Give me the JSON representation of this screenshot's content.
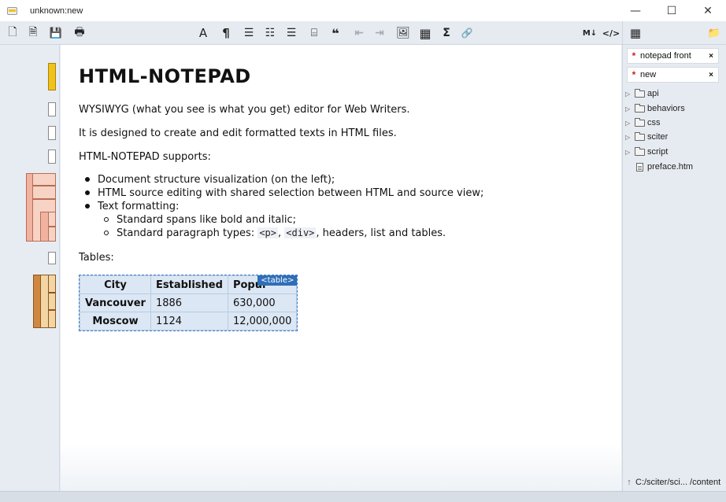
{
  "window": {
    "title": "unknown:new",
    "minimize": "—",
    "maximize": "☐",
    "close": "✕"
  },
  "toolbar": {
    "new": "🗋",
    "open": "🗎",
    "save": "💾",
    "print": "🖶",
    "font": "A",
    "paragraph": "¶",
    "bullets": "☰",
    "numbered": "☷",
    "list": "☰",
    "block": "⌸",
    "quote": "❝",
    "outdent": "⇤",
    "indent": "⇥",
    "image": "🖼",
    "table": "▦",
    "formula": "Σ",
    "link": "🔗",
    "markdown": "M↓",
    "source": "</>"
  },
  "side_toolbar": {
    "tree": "▦",
    "add_folder": "📁"
  },
  "doc": {
    "heading": "HTML-NOTEPAD",
    "p1": "WYSIWYG (what you see is what you get) editor for Web Writers.",
    "p2": "It is designed to create and edit formatted texts in HTML files.",
    "p3": "HTML-NOTEPAD supports:",
    "bullets": [
      "Document structure visualization (on the left);",
      "HTML source editing with shared selection between HTML and source view;",
      "Text formatting:"
    ],
    "sub_bullets": {
      "item1": "Standard spans like bold and italic;",
      "item2_pre": "Standard paragraph types: ",
      "code1": "<p>",
      "sep": ", ",
      "code2": "<div>",
      "item2_post": ", headers, list and tables."
    },
    "tables_label": "Tables:",
    "table": {
      "tag": "<table>",
      "headers": [
        "City",
        "Established",
        "Popul"
      ],
      "rows": [
        [
          "Vancouver",
          "1886",
          "630,000"
        ],
        [
          "Moscow",
          "1124",
          "12,000,000"
        ]
      ]
    }
  },
  "side": {
    "open_files": [
      {
        "mark": "*",
        "name": "notepad front",
        "close": "×"
      },
      {
        "mark": "*",
        "name": "new",
        "close": "×"
      }
    ],
    "tree": [
      {
        "name": "api",
        "arrow": "▷"
      },
      {
        "name": "behaviors",
        "arrow": "▷"
      },
      {
        "name": "css",
        "arrow": "▷"
      },
      {
        "name": "sciter",
        "arrow": "▷"
      },
      {
        "name": "script",
        "arrow": "▷"
      }
    ],
    "file": "preface.htm",
    "path_arrow": "↑",
    "path": "C:/sciter/sci... /content"
  }
}
